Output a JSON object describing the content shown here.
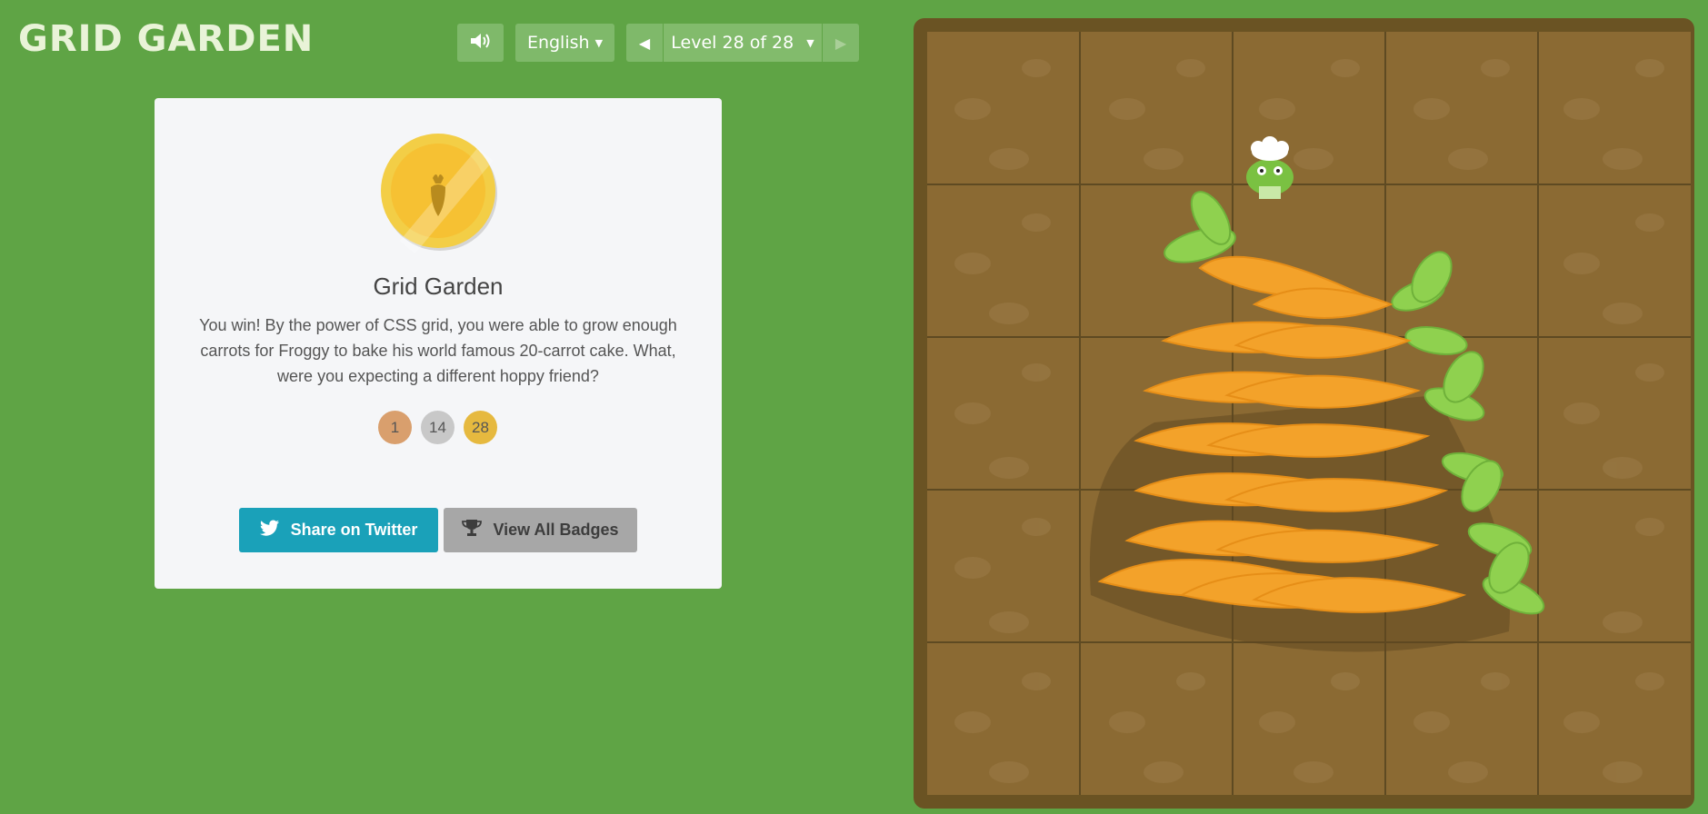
{
  "header": {
    "title": "GRID GARDEN",
    "language": "English",
    "level_label": "Level 28 of 28"
  },
  "card": {
    "title": "Grid Garden",
    "message": "You win! By the power of CSS grid, you were able to grow enough carrots for Froggy to bake his world famous 20-carrot cake. What, were you expecting a different hoppy friend?",
    "badges": [
      "1",
      "14",
      "28"
    ],
    "share_label": "Share on Twitter",
    "view_badges_label": "View All Badges"
  },
  "colors": {
    "background": "#5fa445",
    "twitter": "#1aa1b9",
    "garden_border": "#6a5323",
    "soil": "#8b6a33",
    "carrot": "#f3a22a",
    "leaf": "#8fd14f"
  }
}
